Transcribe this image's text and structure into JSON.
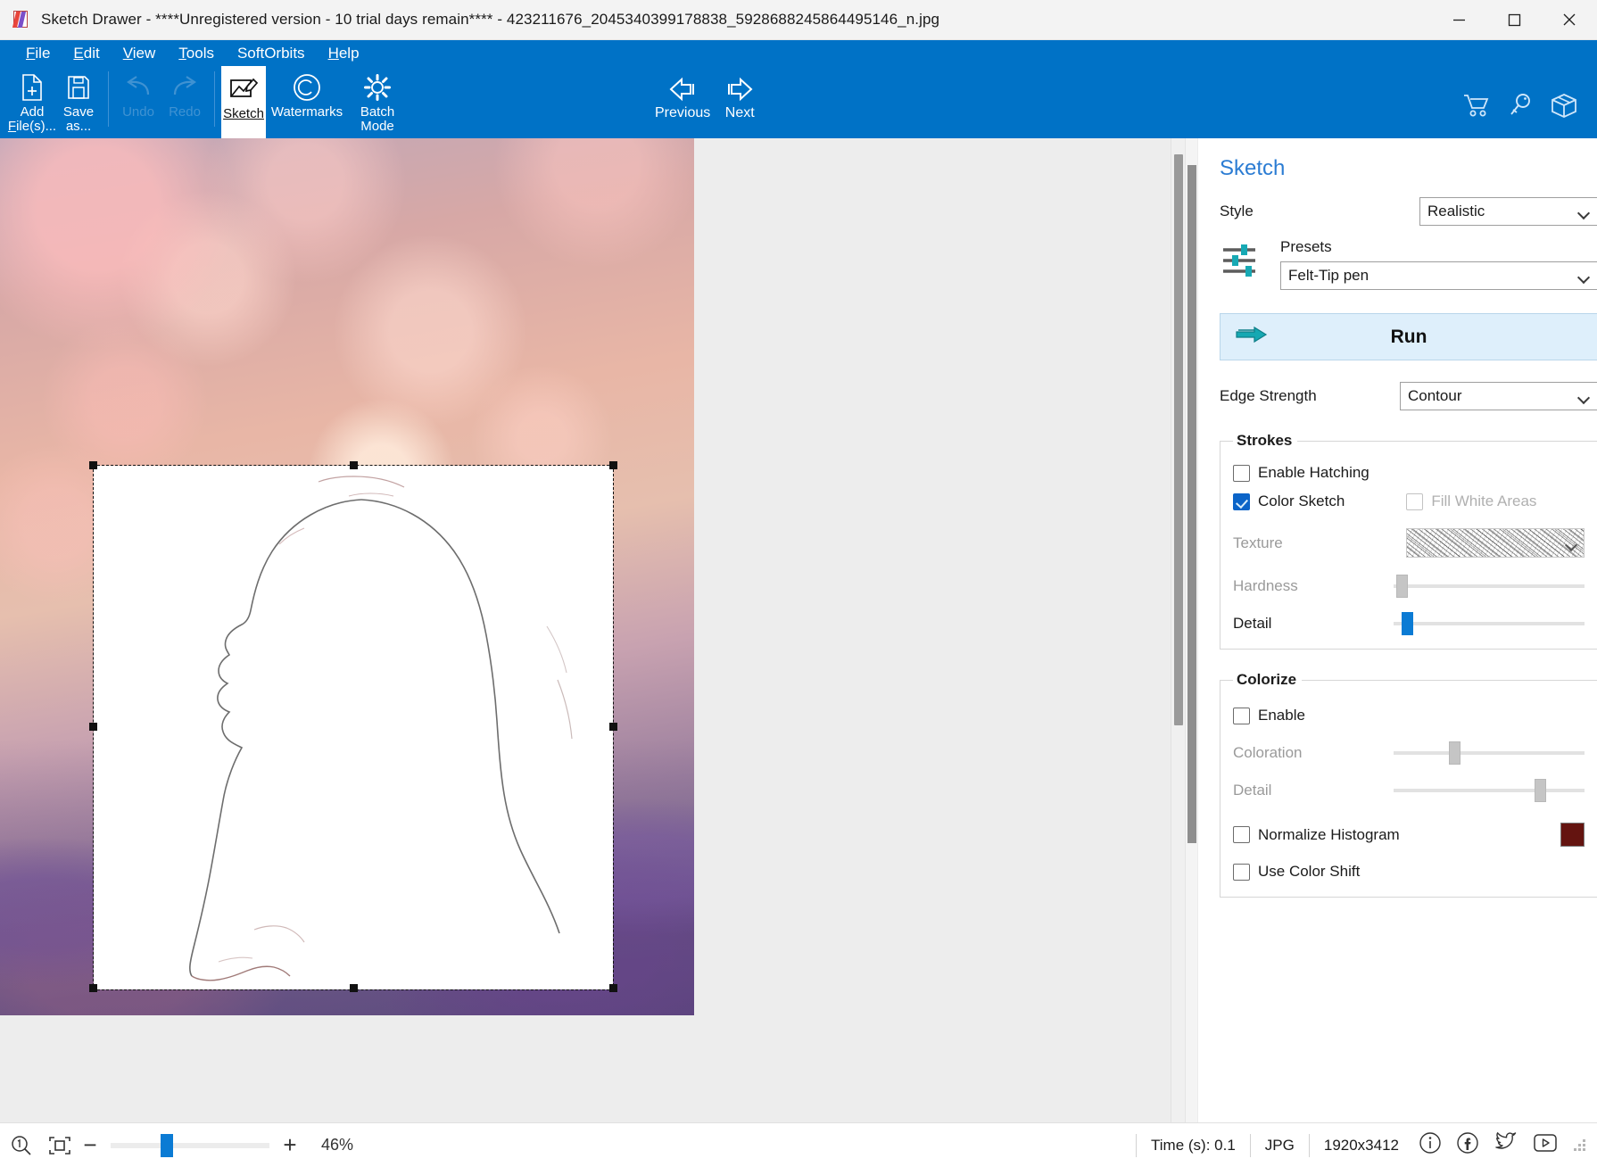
{
  "window": {
    "title": "Sketch Drawer - ****Unregistered version - 10 trial days remain**** - 423211676_2045340399178838_5928688245864495146_n.jpg",
    "app_icon": "sketch-drawer-logo",
    "minimize": "minimize-icon",
    "maximize": "maximize-icon",
    "close": "close-icon"
  },
  "menu": {
    "items": [
      {
        "label": "File",
        "accel": "F"
      },
      {
        "label": "Edit",
        "accel": "E"
      },
      {
        "label": "View",
        "accel": "V"
      },
      {
        "label": "Tools",
        "accel": "T"
      },
      {
        "label": "SoftOrbits",
        "accel": ""
      },
      {
        "label": "Help",
        "accel": "H"
      }
    ]
  },
  "toolbar": {
    "add_files": "Add\nFile(s)...",
    "add_files_line1": "Add",
    "add_files_line2": "File(s)...",
    "save_as_line1": "Save",
    "save_as_line2": "as...",
    "undo": "Undo",
    "redo": "Redo",
    "sketch": "Sketch",
    "watermarks": "Watermarks",
    "batch_line1": "Batch",
    "batch_line2": "Mode",
    "previous": "Previous",
    "next": "Next",
    "cart_icon": "shopping-cart-icon",
    "key_icon": "key-icon",
    "box_icon": "package-box-icon"
  },
  "panel": {
    "title": "Sketch",
    "style_label": "Style",
    "style_value": "Realistic",
    "style_options": [
      "Realistic"
    ],
    "presets_label": "Presets",
    "presets_value": "Felt-Tip pen",
    "presets_options": [
      "Felt-Tip pen"
    ],
    "run_label": "Run",
    "run_icon": "double-arrow-right-icon",
    "edge_strength_label": "Edge Strength",
    "edge_strength_value": "Contour",
    "edge_strength_options": [
      "Contour"
    ],
    "strokes": {
      "legend": "Strokes",
      "enable_hatching_label": "Enable Hatching",
      "enable_hatching_checked": false,
      "color_sketch_label": "Color Sketch",
      "color_sketch_checked": true,
      "fill_white_areas_label": "Fill White Areas",
      "fill_white_areas_checked": false,
      "fill_white_areas_enabled": false,
      "texture_label": "Texture",
      "texture_preview": "pencil-hatch-texture",
      "hardness_label": "Hardness",
      "hardness_value": 3,
      "detail_label": "Detail",
      "detail_value": 6
    },
    "colorize": {
      "legend": "Colorize",
      "enable_label": "Enable",
      "enable_checked": false,
      "coloration_label": "Coloration",
      "coloration_value": 31,
      "detail_label": "Detail",
      "detail_value": 75,
      "normalize_histogram_label": "Normalize Histogram",
      "normalize_histogram_checked": false,
      "use_color_shift_label": "Use Color Shift",
      "use_color_shift_checked": false,
      "color_shift_swatch": "#641410"
    }
  },
  "statusbar": {
    "zoom_reset_icon": "zoom-one-to-one-icon",
    "fit_icon": "fit-to-window-icon",
    "zoom_out": "−",
    "zoom_in": "+",
    "zoom_percent": "46%",
    "zoom_slider_value": 46,
    "time_label": "Time (s): 0.1",
    "format": "JPG",
    "dimensions": "1920x3412",
    "info_icon": "info-circle-icon",
    "facebook_icon": "facebook-icon",
    "twitter_icon": "twitter-bird-icon",
    "youtube_icon": "youtube-icon",
    "resize_grip": "resize-grip-icon"
  },
  "colors": {
    "ribbon_blue": "#0072c6",
    "accent_blue": "#0b7bd4",
    "panel_title_blue": "#2b7cd3",
    "run_bg": "#deeffb",
    "swatch_dark_red": "#641410"
  }
}
